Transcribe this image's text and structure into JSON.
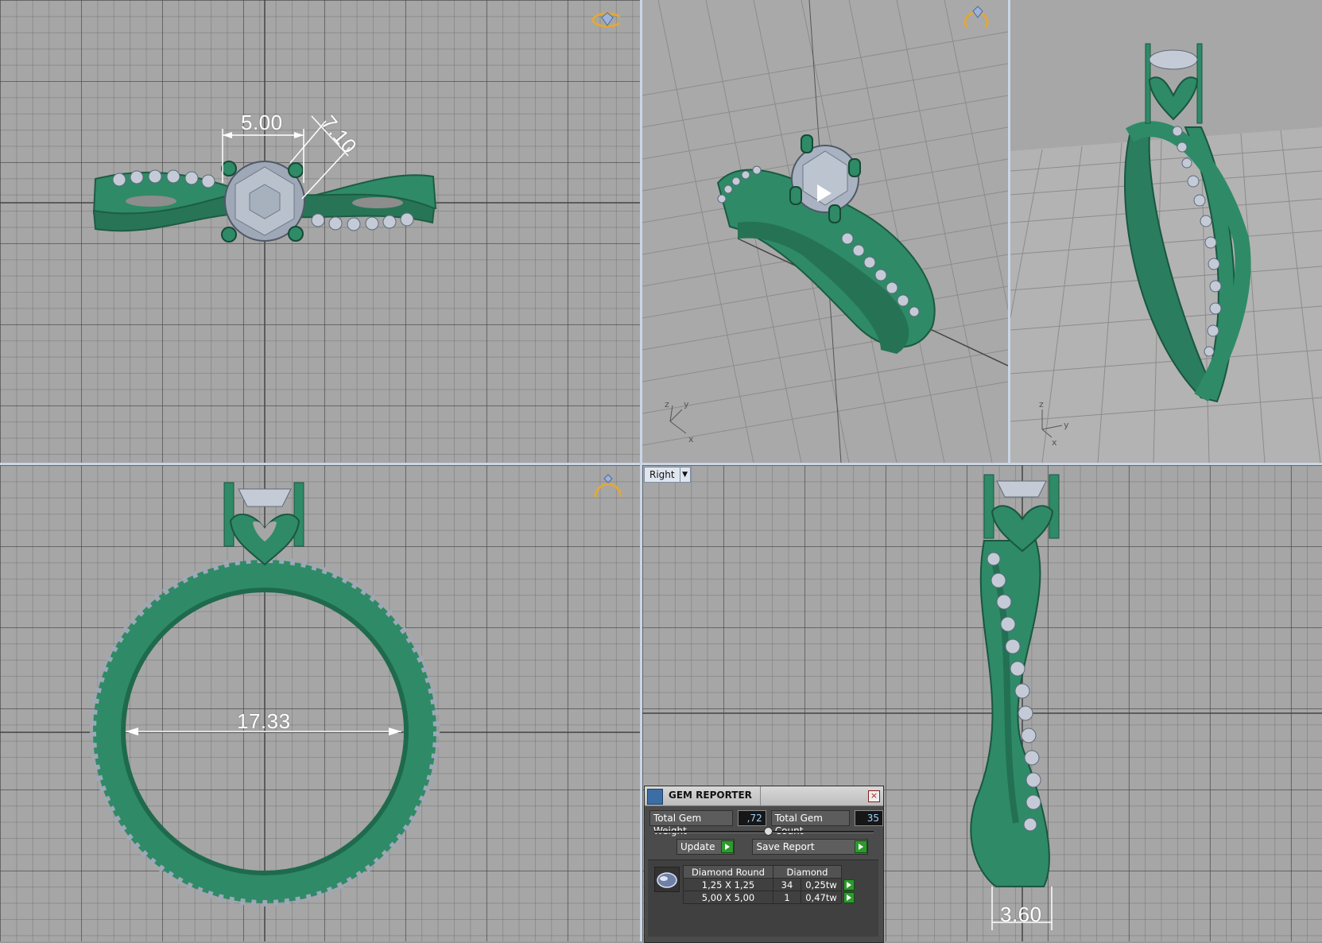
{
  "viewports": {
    "top": {
      "dimensions": {
        "width_label": "5.00",
        "diagonal_label": "7.10"
      }
    },
    "front": {
      "dimensions": {
        "inner_diameter_label": "17.33"
      }
    },
    "right": {
      "view_label": "Right",
      "dimensions": {
        "shank_label": "3.60"
      }
    },
    "perspective": {
      "axis_labels": [
        "z",
        "y",
        "x"
      ]
    },
    "perspective2": {
      "axis_labels": [
        "z",
        "x",
        "y"
      ]
    }
  },
  "gem_reporter": {
    "title": "GEM REPORTER",
    "close": "×",
    "total_weight_label": "Total Gem Weight",
    "total_weight_value": ",72",
    "total_count_label": "Total Gem Count",
    "total_count_value": "35",
    "update_label": "Update",
    "save_label": "Save Report",
    "table_header": {
      "type": "Diamond Round",
      "material": "Diamond"
    },
    "rows": [
      {
        "size": "1,25 X 1,25",
        "count": "34",
        "weight": "0,25tw"
      },
      {
        "size": "5,00 X 5,00",
        "count": "1",
        "weight": "0,47tw"
      }
    ]
  },
  "colors": {
    "metal": "#2f8a67",
    "gem": "#c4cbd6",
    "grid": "#a6a6a6",
    "cube": "#e0a83a"
  }
}
